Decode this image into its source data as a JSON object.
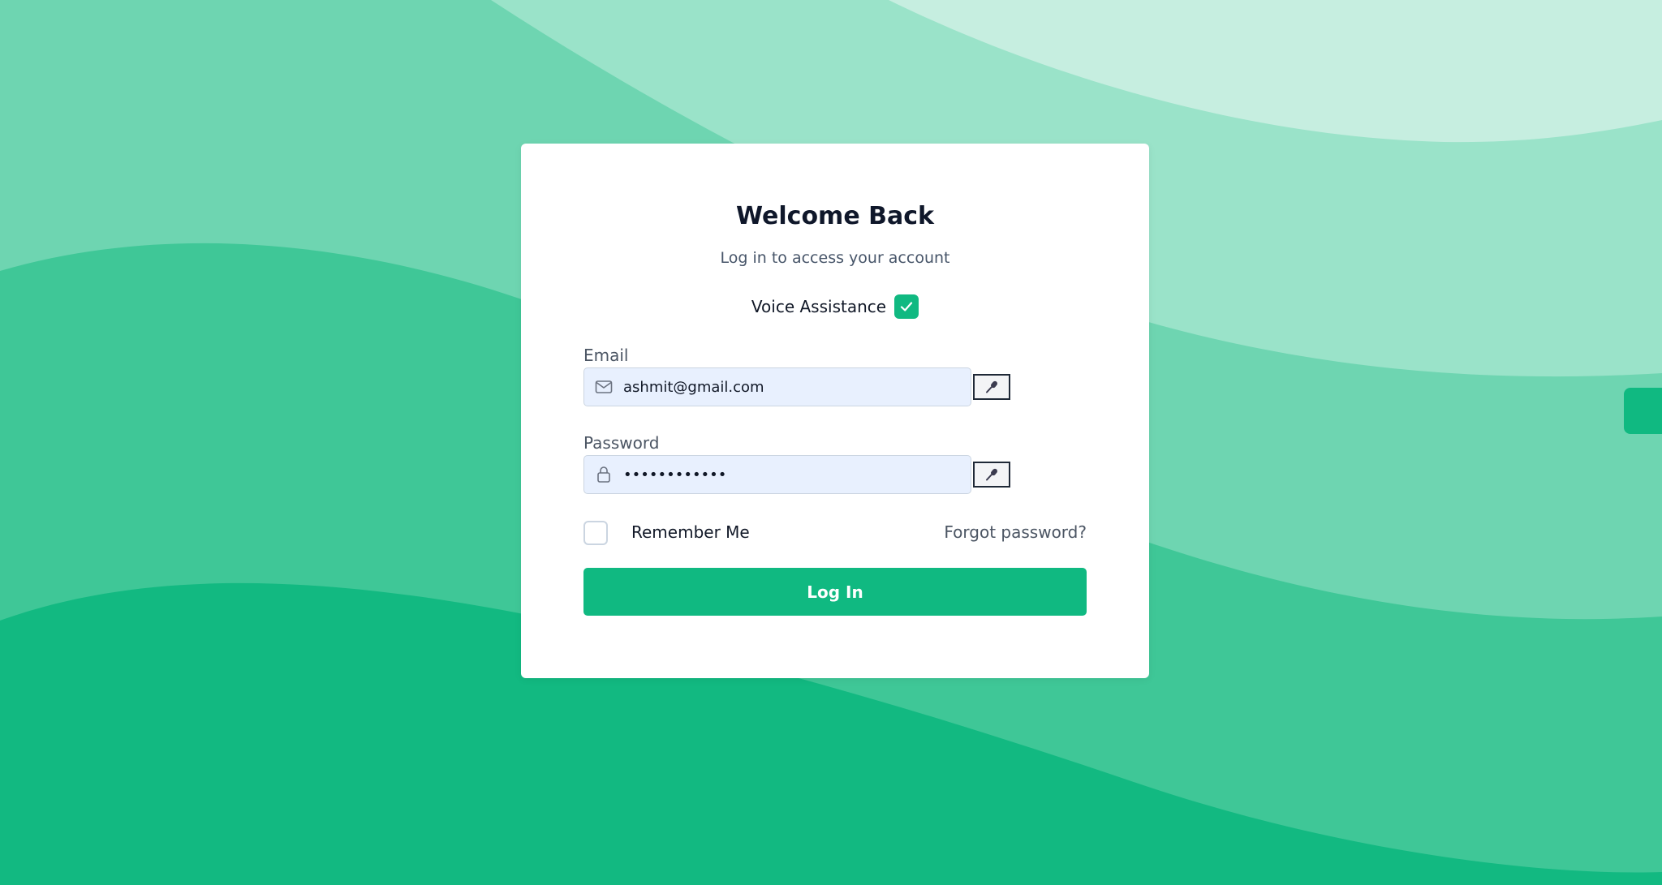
{
  "login": {
    "title": "Welcome Back",
    "subtitle": "Log in to access your account",
    "voice_assistance_label": "Voice Assistance",
    "voice_assistance_checked": true,
    "email_label": "Email",
    "email_value": "ashmit@gmail.com",
    "email_icon": "mail-icon",
    "password_label": "Password",
    "password_value": "••••••••••••",
    "password_icon": "lock-icon",
    "mic_icon": "microphone-icon",
    "remember_me_label": "Remember Me",
    "remember_me_checked": false,
    "forgot_password_label": "Forgot password?",
    "login_button_label": "Log In"
  },
  "colors": {
    "accent": "#10b981",
    "background_dark": "#12b981",
    "background_mid": "#3fc797",
    "background_light": "#6ed5b1",
    "background_lighter": "#9ae3c9",
    "background_lightest": "#c6eee0",
    "input_background": "#e8f0fe",
    "title_text": "#0f172a"
  }
}
